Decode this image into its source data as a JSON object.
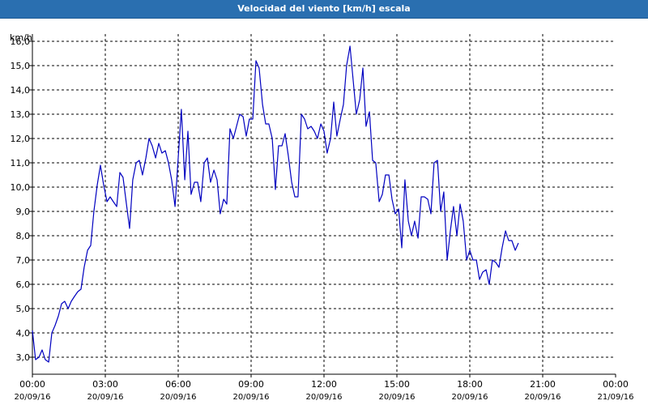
{
  "window": {
    "title": "Velocidad del viento [km/h] escala"
  },
  "chart_data": {
    "type": "line",
    "title": "Velocidad del viento [km/h] escala",
    "ylabel": "km/h",
    "ylim": [
      2.3,
      16.3
    ],
    "xlim": [
      0,
      24
    ],
    "yticks": [
      "3,0",
      "4,0",
      "5,0",
      "6,0",
      "7,0",
      "8,0",
      "9,0",
      "10,0",
      "11,0",
      "12,0",
      "13,0",
      "14,0",
      "15,0",
      "16,0"
    ],
    "xticks": [
      {
        "time": "00:00",
        "date": "20/09/16"
      },
      {
        "time": "03:00",
        "date": "20/09/16"
      },
      {
        "time": "06:00",
        "date": "20/09/16"
      },
      {
        "time": "09:00",
        "date": "20/09/16"
      },
      {
        "time": "12:00",
        "date": "20/09/16"
      },
      {
        "time": "15:00",
        "date": "20/09/16"
      },
      {
        "time": "18:00",
        "date": "20/09/16"
      },
      {
        "time": "21:00",
        "date": "20/09/16"
      },
      {
        "time": "00:00",
        "date": "21/09/16"
      }
    ],
    "grid": true,
    "line_color": "#0000c0",
    "series": [
      {
        "points": [
          [
            0.0,
            4.1
          ],
          [
            0.13,
            2.9
          ],
          [
            0.27,
            3.0
          ],
          [
            0.4,
            3.3
          ],
          [
            0.53,
            2.9
          ],
          [
            0.67,
            2.8
          ],
          [
            0.8,
            4.0
          ],
          [
            0.93,
            4.3
          ],
          [
            1.07,
            4.7
          ],
          [
            1.2,
            5.2
          ],
          [
            1.33,
            5.3
          ],
          [
            1.47,
            5.0
          ],
          [
            1.6,
            5.3
          ],
          [
            1.73,
            5.5
          ],
          [
            1.87,
            5.7
          ],
          [
            2.0,
            5.8
          ],
          [
            2.13,
            6.7
          ],
          [
            2.27,
            7.4
          ],
          [
            2.4,
            7.6
          ],
          [
            2.53,
            9.0
          ],
          [
            2.67,
            10.1
          ],
          [
            2.8,
            10.9
          ],
          [
            2.93,
            10.1
          ],
          [
            3.07,
            9.4
          ],
          [
            3.2,
            9.6
          ],
          [
            3.33,
            9.4
          ],
          [
            3.47,
            9.2
          ],
          [
            3.6,
            10.6
          ],
          [
            3.73,
            10.4
          ],
          [
            3.87,
            9.3
          ],
          [
            4.0,
            8.3
          ],
          [
            4.13,
            10.3
          ],
          [
            4.27,
            11.0
          ],
          [
            4.4,
            11.1
          ],
          [
            4.53,
            10.5
          ],
          [
            4.67,
            11.2
          ],
          [
            4.8,
            12.0
          ],
          [
            4.93,
            11.7
          ],
          [
            5.07,
            11.2
          ],
          [
            5.2,
            11.8
          ],
          [
            5.33,
            11.4
          ],
          [
            5.47,
            11.5
          ],
          [
            5.6,
            11.0
          ],
          [
            5.73,
            10.3
          ],
          [
            5.87,
            9.2
          ],
          [
            6.0,
            11.2
          ],
          [
            6.13,
            13.2
          ],
          [
            6.27,
            10.3
          ],
          [
            6.4,
            12.3
          ],
          [
            6.53,
            9.7
          ],
          [
            6.67,
            10.2
          ],
          [
            6.8,
            10.2
          ],
          [
            6.93,
            9.4
          ],
          [
            7.07,
            11.0
          ],
          [
            7.2,
            11.2
          ],
          [
            7.33,
            10.2
          ],
          [
            7.47,
            10.7
          ],
          [
            7.6,
            10.3
          ],
          [
            7.73,
            8.9
          ],
          [
            7.87,
            9.5
          ],
          [
            8.0,
            9.3
          ],
          [
            8.13,
            12.4
          ],
          [
            8.27,
            12.0
          ],
          [
            8.4,
            12.5
          ],
          [
            8.53,
            13.0
          ],
          [
            8.67,
            12.9
          ],
          [
            8.8,
            12.1
          ],
          [
            8.93,
            12.8
          ],
          [
            9.07,
            12.8
          ],
          [
            9.2,
            15.2
          ],
          [
            9.33,
            14.9
          ],
          [
            9.47,
            13.4
          ],
          [
            9.6,
            12.6
          ],
          [
            9.73,
            12.6
          ],
          [
            9.87,
            12.0
          ],
          [
            10.0,
            9.9
          ],
          [
            10.13,
            11.7
          ],
          [
            10.27,
            11.7
          ],
          [
            10.4,
            12.2
          ],
          [
            10.53,
            11.3
          ],
          [
            10.67,
            10.2
          ],
          [
            10.8,
            9.6
          ],
          [
            10.93,
            9.6
          ],
          [
            11.07,
            13.0
          ],
          [
            11.2,
            12.8
          ],
          [
            11.33,
            12.4
          ],
          [
            11.47,
            12.5
          ],
          [
            11.6,
            12.3
          ],
          [
            11.73,
            12.0
          ],
          [
            11.87,
            12.6
          ],
          [
            12.0,
            12.3
          ],
          [
            12.13,
            11.4
          ],
          [
            12.27,
            12.0
          ],
          [
            12.4,
            13.5
          ],
          [
            12.53,
            12.1
          ],
          [
            12.67,
            12.8
          ],
          [
            12.8,
            13.4
          ],
          [
            12.93,
            15.0
          ],
          [
            13.07,
            15.8
          ],
          [
            13.2,
            14.4
          ],
          [
            13.33,
            13.0
          ],
          [
            13.47,
            13.6
          ],
          [
            13.6,
            14.9
          ],
          [
            13.73,
            12.5
          ],
          [
            13.87,
            13.1
          ],
          [
            14.0,
            11.1
          ],
          [
            14.13,
            11.0
          ],
          [
            14.27,
            9.4
          ],
          [
            14.4,
            9.7
          ],
          [
            14.53,
            10.5
          ],
          [
            14.67,
            10.5
          ],
          [
            14.8,
            9.5
          ],
          [
            14.93,
            8.9
          ],
          [
            15.07,
            9.1
          ],
          [
            15.2,
            7.5
          ],
          [
            15.33,
            10.3
          ],
          [
            15.47,
            8.6
          ],
          [
            15.6,
            8.0
          ],
          [
            15.73,
            8.6
          ],
          [
            15.87,
            7.9
          ],
          [
            16.0,
            9.6
          ],
          [
            16.13,
            9.6
          ],
          [
            16.27,
            9.5
          ],
          [
            16.4,
            8.9
          ],
          [
            16.53,
            11.0
          ],
          [
            16.67,
            11.1
          ],
          [
            16.8,
            9.0
          ],
          [
            16.93,
            9.8
          ],
          [
            17.07,
            7.0
          ],
          [
            17.2,
            8.2
          ],
          [
            17.33,
            9.2
          ],
          [
            17.47,
            8.0
          ],
          [
            17.6,
            9.3
          ],
          [
            17.73,
            8.6
          ],
          [
            17.87,
            7.0
          ],
          [
            18.0,
            7.4
          ],
          [
            18.13,
            7.0
          ],
          [
            18.27,
            7.0
          ],
          [
            18.4,
            6.2
          ],
          [
            18.53,
            6.5
          ],
          [
            18.67,
            6.6
          ],
          [
            18.8,
            6.0
          ],
          [
            18.93,
            7.0
          ],
          [
            19.07,
            6.9
          ],
          [
            19.2,
            6.7
          ],
          [
            19.33,
            7.5
          ],
          [
            19.47,
            8.2
          ],
          [
            19.6,
            7.8
          ],
          [
            19.73,
            7.8
          ],
          [
            19.87,
            7.4
          ],
          [
            20.0,
            7.7
          ]
        ]
      }
    ]
  }
}
